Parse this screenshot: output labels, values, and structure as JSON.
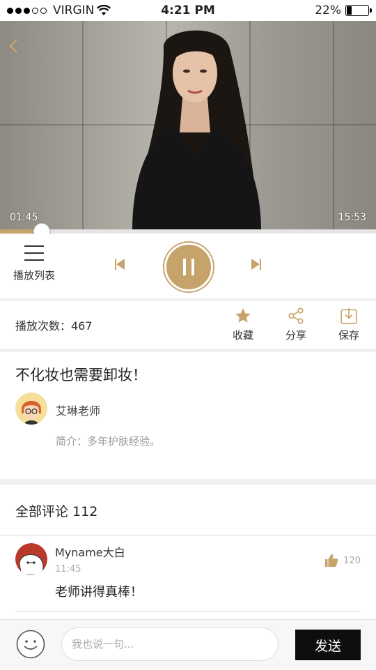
{
  "status_bar": {
    "carrier": "VIRGIN",
    "time": "4:21 PM",
    "battery": "22%",
    "signal_bars_filled": 3,
    "signal_bars_total": 5
  },
  "player": {
    "current_time": "01:45",
    "total_time": "15:53",
    "progress_fraction": 0.11,
    "playlist_label": "播放列表",
    "state": "playing"
  },
  "stats": {
    "play_count_label": "播放次数：467",
    "actions": [
      {
        "label": "收藏",
        "icon": "star-icon"
      },
      {
        "label": "分享",
        "icon": "share-icon"
      },
      {
        "label": "保存",
        "icon": "download-icon"
      }
    ]
  },
  "lesson": {
    "title": "不化妆也需要卸妆！",
    "teacher": "艾琳老师",
    "intro": "简介：多年护肤经验。"
  },
  "comments": {
    "header": "全部评论 112",
    "items": [
      {
        "user": "Myname大白",
        "time": "11:45",
        "text": "老师讲得真棒！",
        "likes": "120"
      }
    ]
  },
  "compose": {
    "placeholder": "我也说一句...",
    "send_label": "发送"
  },
  "colors": {
    "accent": "#c6a36a",
    "send_button": "#0e0e0e"
  }
}
